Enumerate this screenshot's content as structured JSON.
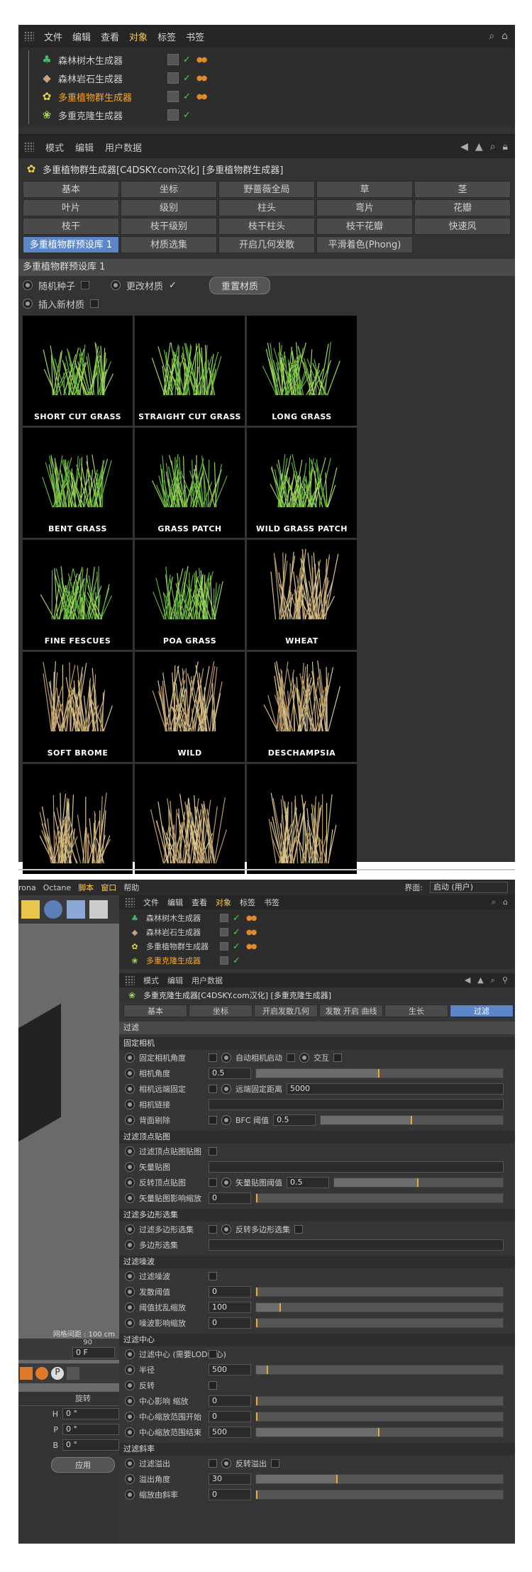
{
  "panel1": {
    "menu": [
      "文件",
      "编辑",
      "查看",
      "对象",
      "标签",
      "书签"
    ],
    "objects": [
      {
        "name": "森林树木生成器",
        "selected": false
      },
      {
        "name": "森林岩石生成器",
        "selected": false
      },
      {
        "name": "多重植物群生成器",
        "selected": true
      },
      {
        "name": "多重克隆生成器",
        "selected": false
      }
    ],
    "attr_menu": [
      "模式",
      "编辑",
      "用户数据"
    ],
    "title": "多重植物群生成器[C4DSKY.com汉化] [多重植物群生成器]",
    "tabs": [
      "基本",
      "坐标",
      "野蔷薇全局",
      "草",
      "茎",
      "叶片",
      "级别",
      "柱头",
      "弯片",
      "花瓣",
      "枝干",
      "枝干级别",
      "枝干柱头",
      "枝干花瓣",
      "快速风",
      "多重植物群预设库 1",
      "材质选集",
      "开启几何发散",
      "平滑着色(Phong)"
    ],
    "active_tab": "多重植物群预设库 1",
    "section": "多重植物群预设库 1",
    "opt_random": "随机种子",
    "opt_change": "更改材质",
    "opt_insert": "插入新材质",
    "btn_reset": "重置材质",
    "presets": [
      "SHORT CUT GRASS",
      "STRAIGHT CUT GRASS",
      "LONG GRASS",
      "BENT GRASS",
      "GRASS PATCH",
      "WILD GRASS PATCH",
      "FINE FESCUES",
      "POA GRASS",
      "WHEAT",
      "SOFT BROME",
      "WILD",
      "DESCHAMPSIA",
      "",
      "",
      ""
    ]
  },
  "panel2": {
    "topmenu": [
      "rona",
      "Octane",
      "脚本",
      "窗口",
      "帮助"
    ],
    "interface_label": "界面:",
    "interface_value": "启动 (用户)",
    "menu": [
      "文件",
      "编辑",
      "查看",
      "对象",
      "标签",
      "书签"
    ],
    "objects": [
      {
        "name": "森林树木生成器",
        "selected": false
      },
      {
        "name": "森林岩石生成器",
        "selected": false
      },
      {
        "name": "多重植物群生成器",
        "selected": false
      },
      {
        "name": "多重克隆生成器",
        "selected": true
      }
    ],
    "attr_menu": [
      "模式",
      "编辑",
      "用户数据"
    ],
    "title": "多重克隆生成器[C4DSKY.com汉化] [多重克隆生成器]",
    "tabs": [
      "基本",
      "坐标",
      "开启发散几何",
      "发散 开启 曲线",
      "生长",
      "过滤"
    ],
    "active_tab": "过滤",
    "section": "过滤",
    "grid_label": "网格间距 : 100 cm",
    "groups": [
      {
        "head": "固定相机",
        "rows": [
          {
            "label": "固定相机角度",
            "extra": "自动相机启动",
            "extra2": "交互"
          },
          {
            "label": "相机角度",
            "value": "0.5",
            "fill": 0.5
          },
          {
            "label": "相机远端固定",
            "extra": "远端固定距离",
            "value": "5000"
          },
          {
            "label": "相机链接",
            "value": ""
          },
          {
            "label": "背面剔除",
            "extra": "BFC 阈值",
            "value": "0.5",
            "fill": 0.5
          }
        ]
      },
      {
        "head": "过滤顶点贴图",
        "rows": [
          {
            "label": "过滤顶点贴图贴图"
          },
          {
            "label": "矢量贴图",
            "value": ""
          },
          {
            "label": "反转顶点贴图",
            "extra": "矢量贴图阈值",
            "value": "0.5",
            "fill": 0.5
          },
          {
            "label": "矢量贴图影响缩放",
            "value": "0",
            "fill": 0
          }
        ]
      },
      {
        "head": "过滤多边形选集",
        "rows": [
          {
            "label": "过滤多边形选集",
            "extra": "反转多边形选集"
          },
          {
            "label": "多边形选集",
            "value": ""
          }
        ]
      },
      {
        "head": "过滤噪波",
        "rows": [
          {
            "label": "过滤噪波"
          },
          {
            "label": "发散阈值",
            "value": "0",
            "fill": 0
          },
          {
            "label": "阈值扰乱缩放",
            "value": "100",
            "fill": 0.1
          },
          {
            "label": "噪波影响缩放",
            "value": "0",
            "fill": 0
          }
        ]
      },
      {
        "head": "过滤中心",
        "rows": [
          {
            "label": "过滤中心 (需要LOD中心)"
          },
          {
            "label": "半径",
            "value": "500",
            "fill": 0.05
          },
          {
            "label": "反转"
          },
          {
            "label": "中心影响 缩放",
            "value": "0",
            "fill": 0
          },
          {
            "label": "中心缩放范围开始",
            "value": "0",
            "fill": 0
          },
          {
            "label": "中心缩放范围结束",
            "value": "500",
            "fill": 0.5
          }
        ]
      },
      {
        "head": "过滤斜率",
        "rows": [
          {
            "label": "过滤溢出",
            "extra": "反转溢出"
          },
          {
            "label": "溢出角度",
            "value": "30",
            "fill": 0.33
          },
          {
            "label": "缩放由斜率",
            "value": "0",
            "fill": 0
          }
        ]
      }
    ],
    "left_labels": [
      "旋转",
      "H",
      "P",
      "B",
      "应用"
    ],
    "left_values": [
      "0 °",
      "0 °",
      "0 °"
    ],
    "frame_value": "0 F",
    "frame_max": "90"
  },
  "colors": {
    "accent": "#5d86c9",
    "highlight": "#f0a830",
    "grass": "#6fae3c"
  }
}
